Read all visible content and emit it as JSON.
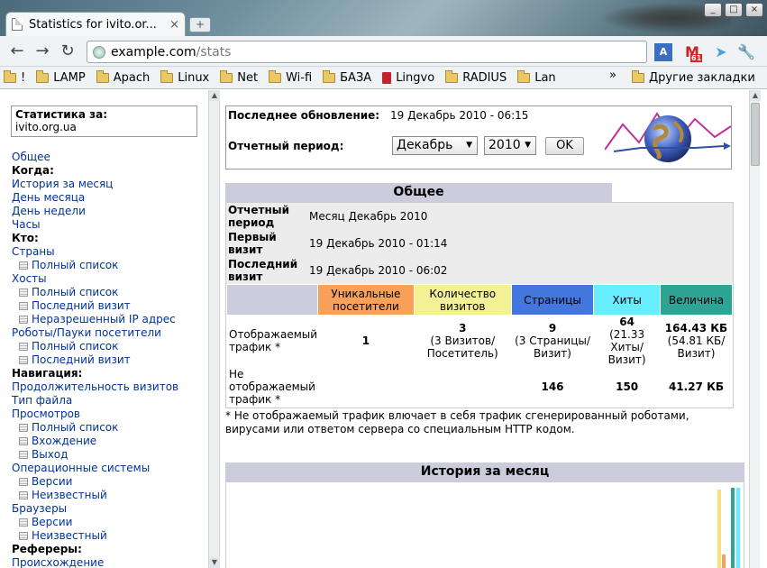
{
  "browser": {
    "tab_title": "Statistics for ivito.or...",
    "tab_close": "×",
    "new_tab": "+",
    "url_host": "example.com",
    "url_path": "/stats",
    "gmail_count": "61",
    "window_buttons": [
      "_",
      "□",
      "×"
    ]
  },
  "bookmarks": {
    "items": [
      "!",
      "LAMP",
      "Apach",
      "Linux",
      "Net",
      "Wi-fi",
      "БАЗА",
      "Lingvo",
      "RADIUS",
      "Lan"
    ],
    "more": "»",
    "other": "Другие закладки"
  },
  "sidebar": {
    "stats_label": "Статистика за:",
    "site": "ivito.org.ua",
    "rows": [
      {
        "type": "link",
        "text": "Общее"
      },
      {
        "type": "hdr",
        "text": "Когда:"
      },
      {
        "type": "link",
        "text": "История за месяц"
      },
      {
        "type": "link",
        "text": "День месяца"
      },
      {
        "type": "link",
        "text": "День недели"
      },
      {
        "type": "link",
        "text": "Часы"
      },
      {
        "type": "hdr",
        "text": "Кто:"
      },
      {
        "type": "link",
        "text": "Страны"
      },
      {
        "type": "sub",
        "text": "Полный список"
      },
      {
        "type": "link",
        "text": "Хосты"
      },
      {
        "type": "sub",
        "text": "Полный список"
      },
      {
        "type": "sub",
        "text": "Последний визит"
      },
      {
        "type": "sub",
        "text": "Неразрешенный IP адрес"
      },
      {
        "type": "link",
        "text": "Роботы/Пауки посетители"
      },
      {
        "type": "sub",
        "text": "Полный список"
      },
      {
        "type": "sub",
        "text": "Последний визит"
      },
      {
        "type": "hdr",
        "text": "Навигация:"
      },
      {
        "type": "link",
        "text": "Продолжительность визитов"
      },
      {
        "type": "link",
        "text": "Тип файла"
      },
      {
        "type": "link",
        "text": "Просмотров"
      },
      {
        "type": "sub",
        "text": "Полный список"
      },
      {
        "type": "sub",
        "text": "Вхождение"
      },
      {
        "type": "sub",
        "text": "Выход"
      },
      {
        "type": "link",
        "text": "Операционные системы"
      },
      {
        "type": "sub",
        "text": "Версии"
      },
      {
        "type": "sub",
        "text": "Неизвестный"
      },
      {
        "type": "link",
        "text": "Браузеры"
      },
      {
        "type": "sub",
        "text": "Версии"
      },
      {
        "type": "sub",
        "text": "Неизвестный"
      },
      {
        "type": "hdr",
        "text": "Рефереры:"
      },
      {
        "type": "link",
        "text": "Происхождение"
      }
    ]
  },
  "summary": {
    "last_update_label": "Последнее обновление:",
    "last_update_value": "19 Декабрь 2010 - 06:15",
    "period_label": "Отчетный период:",
    "month_selected": "Декабрь",
    "year_selected": "2010",
    "ok_label": "OK"
  },
  "general": {
    "title": "Общее",
    "period_key": "Отчетный период",
    "period_value": "Месяц Декабрь 2010",
    "first_visit_key": "Первый визит",
    "first_visit_value": "19 Декабрь 2010 - 01:14",
    "last_visit_key": "Последний визит",
    "last_visit_value": "19 Декабрь 2010 - 06:02",
    "columns": [
      {
        "label": "Уникальные посетители",
        "color": "#f9a05a"
      },
      {
        "label": "Количество визитов",
        "color": "#f4f095"
      },
      {
        "label": "Страницы",
        "color": "#4477dd"
      },
      {
        "label": "Хиты",
        "color": "#66eeff"
      },
      {
        "label": "Величина",
        "color": "#2ea495"
      }
    ],
    "shown_label": "Отображаемый трафик *",
    "shown": {
      "unique": "1",
      "visits": "3",
      "visits_sub": "(3 Визитов/ Посетитель)",
      "pages": "9",
      "pages_sub": "(3 Страницы/ Визит)",
      "hits": "64",
      "hits_sub": "(21.33 Хиты/ Визит)",
      "bandwidth": "164.43 КБ",
      "bandwidth_sub": "(54.81 КБ/ Визит)"
    },
    "notshown_label": "Не отображаемый трафик *",
    "notshown": {
      "pages": "146",
      "hits": "150",
      "bandwidth": "41.27 КБ"
    },
    "footnote": "* Не отображаемый трафик влючает в себя трафик сгенерированный роботами, вирусами или ответом сервера со специальным HTTP кодом."
  },
  "history": {
    "title": "История за месяц"
  }
}
